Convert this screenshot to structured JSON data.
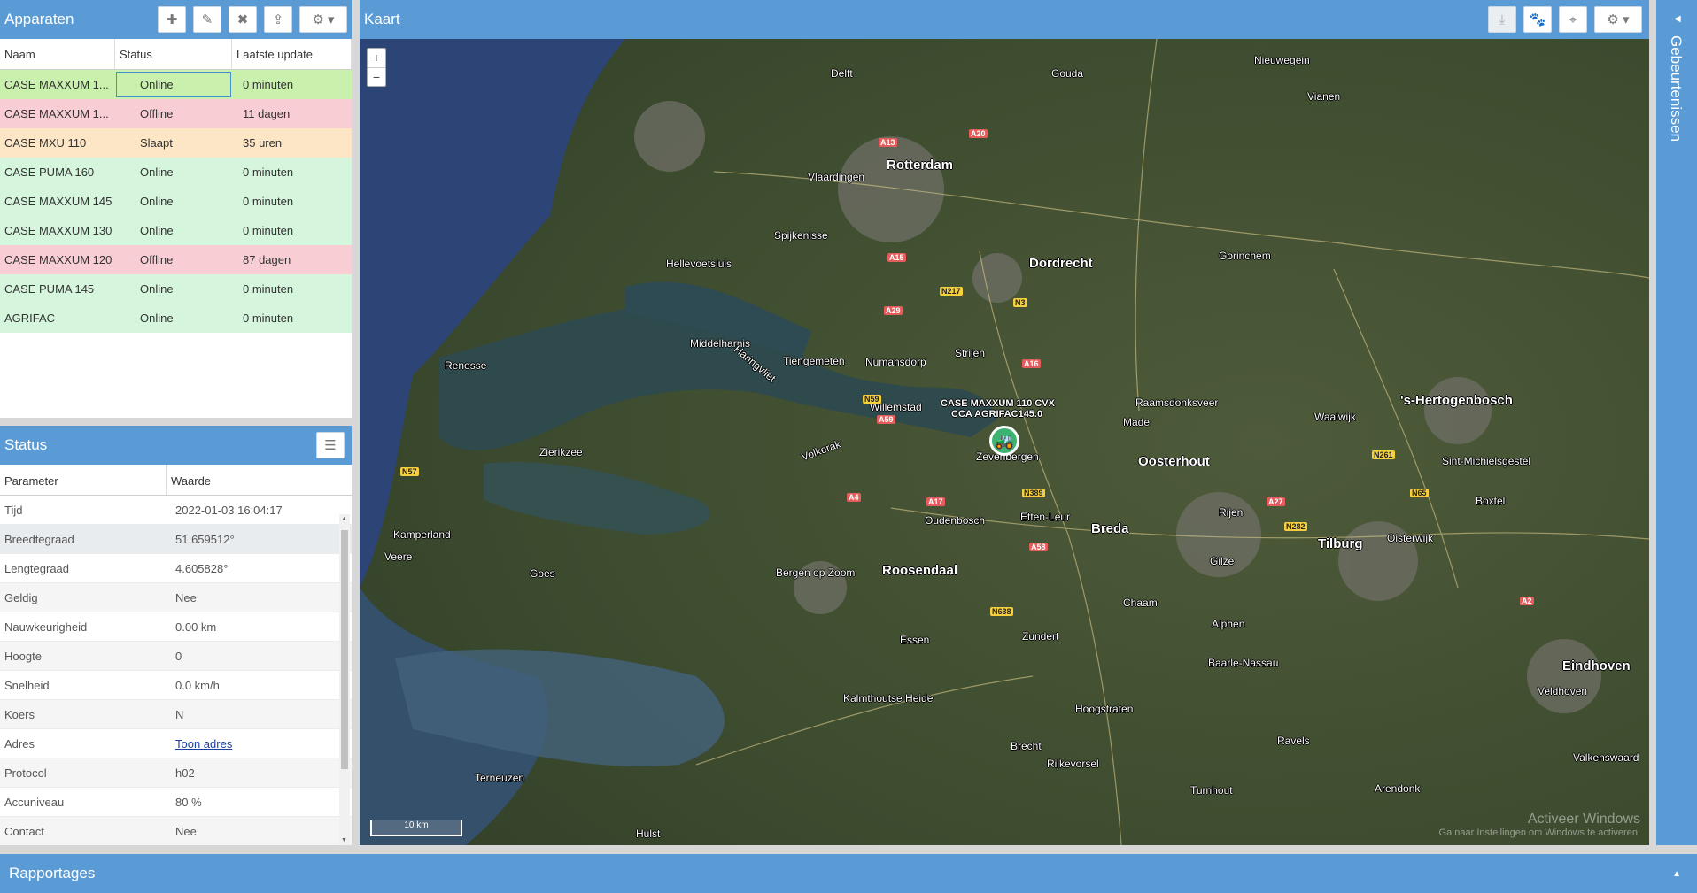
{
  "devices": {
    "title": "Apparaten",
    "columns": [
      "Naam",
      "Status",
      "Laatste update"
    ],
    "rows": [
      {
        "name": "CASE MAXXUM 1...",
        "status": "Online",
        "update": "0 minuten"
      },
      {
        "name": "CASE MAXXUM 1...",
        "status": "Offline",
        "update": "11 dagen"
      },
      {
        "name": "CASE MXU 110",
        "status": "Slaapt",
        "update": "35 uren"
      },
      {
        "name": "CASE PUMA 160",
        "status": "Online",
        "update": "0 minuten"
      },
      {
        "name": "CASE MAXXUM 145",
        "status": "Online",
        "update": "0 minuten"
      },
      {
        "name": "CASE MAXXUM 130",
        "status": "Online",
        "update": "0 minuten"
      },
      {
        "name": "CASE MAXXUM 120",
        "status": "Offline",
        "update": "87 dagen"
      },
      {
        "name": "CASE PUMA 145",
        "status": "Online",
        "update": "0 minuten"
      },
      {
        "name": "AGRIFAC",
        "status": "Online",
        "update": "0 minuten"
      }
    ],
    "toolbar_icons": [
      "plus-icon",
      "pencil-icon",
      "remove-icon",
      "upload-icon",
      "gear-dropdown-icon"
    ]
  },
  "status": {
    "title": "Status",
    "columns": [
      "Parameter",
      "Waarde"
    ],
    "rows": [
      {
        "param": "Tijd",
        "value": "2022-01-03 16:04:17"
      },
      {
        "param": "Breedtegraad",
        "value": "51.659512°"
      },
      {
        "param": "Lengtegraad",
        "value": "4.605828°"
      },
      {
        "param": "Geldig",
        "value": "Nee"
      },
      {
        "param": "Nauwkeurigheid",
        "value": "0.00 km"
      },
      {
        "param": "Hoogte",
        "value": "0"
      },
      {
        "param": "Snelheid",
        "value": "0.0 km/h"
      },
      {
        "param": "Koers",
        "value": "N"
      },
      {
        "param": "Adres",
        "value": "Toon adres"
      },
      {
        "param": "Protocol",
        "value": "h02"
      },
      {
        "param": "Accuniveau",
        "value": "80 %"
      },
      {
        "param": "Contact",
        "value": "Nee"
      }
    ]
  },
  "map": {
    "title": "Kaart",
    "zoom_in": "+",
    "zoom_out": "−",
    "scale": "10 km",
    "marker_labels": [
      "CASE MAXXUM 110 CVX",
      "CCA AGRIFAC145.0"
    ],
    "watermark_line1": "Activeer Windows",
    "watermark_line2": "Ga naar Instellingen om Windows te activeren.",
    "cities": [
      {
        "name": "Rotterdam",
        "big": true
      },
      {
        "name": "Dordrecht",
        "big": true
      },
      {
        "name": "Breda",
        "big": true
      },
      {
        "name": "Tilburg",
        "big": true
      },
      {
        "name": "Eindhoven",
        "big": true
      },
      {
        "name": "Roosendaal",
        "big": true
      },
      {
        "name": "Oosterhout",
        "big": true
      },
      {
        "name": "'s-Hertogenbosch",
        "big": true
      },
      {
        "name": "Delft",
        "big": false
      },
      {
        "name": "Gouda",
        "big": false
      },
      {
        "name": "Nieuwegein",
        "big": false
      },
      {
        "name": "Vlaardingen",
        "big": false
      },
      {
        "name": "Spijkenisse",
        "big": false
      },
      {
        "name": "Hellevoetsluis",
        "big": false
      },
      {
        "name": "Middelharnis",
        "big": false
      },
      {
        "name": "Tiengemeten",
        "big": false
      },
      {
        "name": "Numansdorp",
        "big": false
      },
      {
        "name": "Strijen",
        "big": false
      },
      {
        "name": "Willemstad",
        "big": false
      },
      {
        "name": "Zevenbergen",
        "big": false
      },
      {
        "name": "Bergen op Zoom",
        "big": false
      },
      {
        "name": "Etten-Leur",
        "big": false
      },
      {
        "name": "Oudenbosch",
        "big": false
      },
      {
        "name": "Kalmthoutse Heide",
        "big": false
      },
      {
        "name": "Turnhout",
        "big": false
      },
      {
        "name": "Gorinchem",
        "big": false
      },
      {
        "name": "Vianen",
        "big": false
      },
      {
        "name": "Waalwijk",
        "big": false
      },
      {
        "name": "Renesse",
        "big": false
      },
      {
        "name": "Zierikzee",
        "big": false
      },
      {
        "name": "Goes",
        "big": false
      },
      {
        "name": "Terneuzen",
        "big": false
      },
      {
        "name": "Hulst",
        "big": false
      },
      {
        "name": "Veere",
        "big": false
      },
      {
        "name": "Kamperland",
        "big": false
      },
      {
        "name": "Essen",
        "big": false
      },
      {
        "name": "Zundert",
        "big": false
      },
      {
        "name": "Hoogstraten",
        "big": false
      },
      {
        "name": "Rijkevorsel",
        "big": false
      },
      {
        "name": "Brecht",
        "big": false
      },
      {
        "name": "Gilze",
        "big": false
      },
      {
        "name": "Rijen",
        "big": false
      },
      {
        "name": "Made",
        "big": false
      },
      {
        "name": "Raamsdonksveer",
        "big": false
      },
      {
        "name": "Sint-Michielsgestel",
        "big": false
      },
      {
        "name": "Boxtel",
        "big": false
      },
      {
        "name": "Oisterwijk",
        "big": false
      },
      {
        "name": "Veldhoven",
        "big": false
      },
      {
        "name": "Valkenswaard",
        "big": false
      },
      {
        "name": "Arendonk",
        "big": false
      },
      {
        "name": "Ravels",
        "big": false
      },
      {
        "name": "Baarle-Nassau",
        "big": false
      },
      {
        "name": "Alphen",
        "big": false
      },
      {
        "name": "Chaam",
        "big": false
      },
      {
        "name": "Volkerak",
        "big": false
      },
      {
        "name": "Haringvliet",
        "big": false
      }
    ],
    "roads": [
      "A15",
      "A16",
      "A17",
      "A27",
      "A29",
      "A58",
      "A59",
      "A4",
      "A2",
      "A20",
      "A13",
      "N57",
      "N59",
      "N217",
      "N3",
      "N261",
      "N65",
      "N282",
      "N638",
      "N389"
    ]
  },
  "events": {
    "title": "Gebeurtenissen"
  },
  "reports": {
    "title": "Rapportages"
  },
  "colors": {
    "header": "#5b9bd5",
    "online": "#d5f5dc",
    "offline": "#f8cdd4",
    "sleep": "#fde6c5"
  }
}
